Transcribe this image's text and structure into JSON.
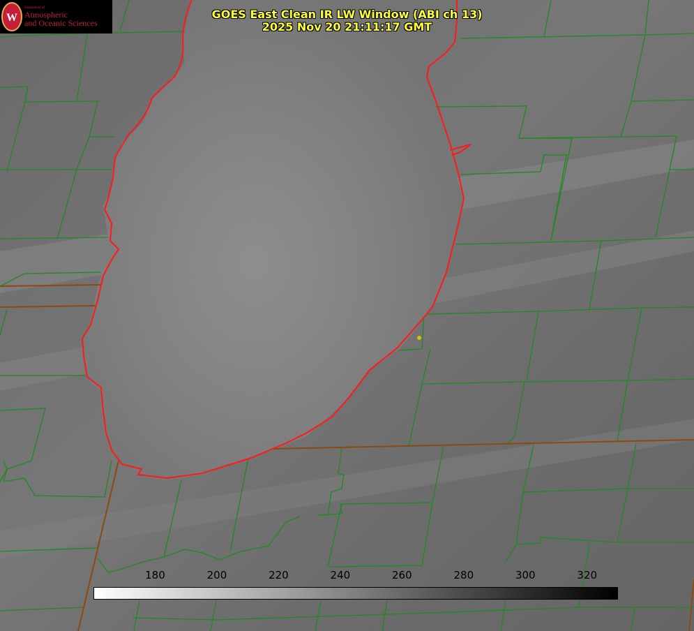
{
  "title": {
    "line1": "GOES East Clean IR LW Window (ABI ch 13)",
    "line2": "2025 Nov 20 21:11:17 GMT"
  },
  "logo": {
    "department": "Department of",
    "name_line1": "Atmospheric",
    "name_line2": "and Oceanic Sciences",
    "seal_letter": "W"
  },
  "colorbar": {
    "min": 160,
    "max": 330,
    "ticks": [
      "180",
      "200",
      "220",
      "240",
      "260",
      "280",
      "300",
      "320"
    ],
    "colormap": "white-to-black"
  },
  "colors": {
    "county_lines": "#1f8a1f",
    "state_lines": "#8a4a10",
    "lake_outline": "#ff1a1a",
    "title_text": "#ffff33",
    "station_marker": "#d4c200"
  },
  "map_features": [
    "lake-outline",
    "county-boundaries",
    "state-boundaries",
    "station-marker"
  ]
}
